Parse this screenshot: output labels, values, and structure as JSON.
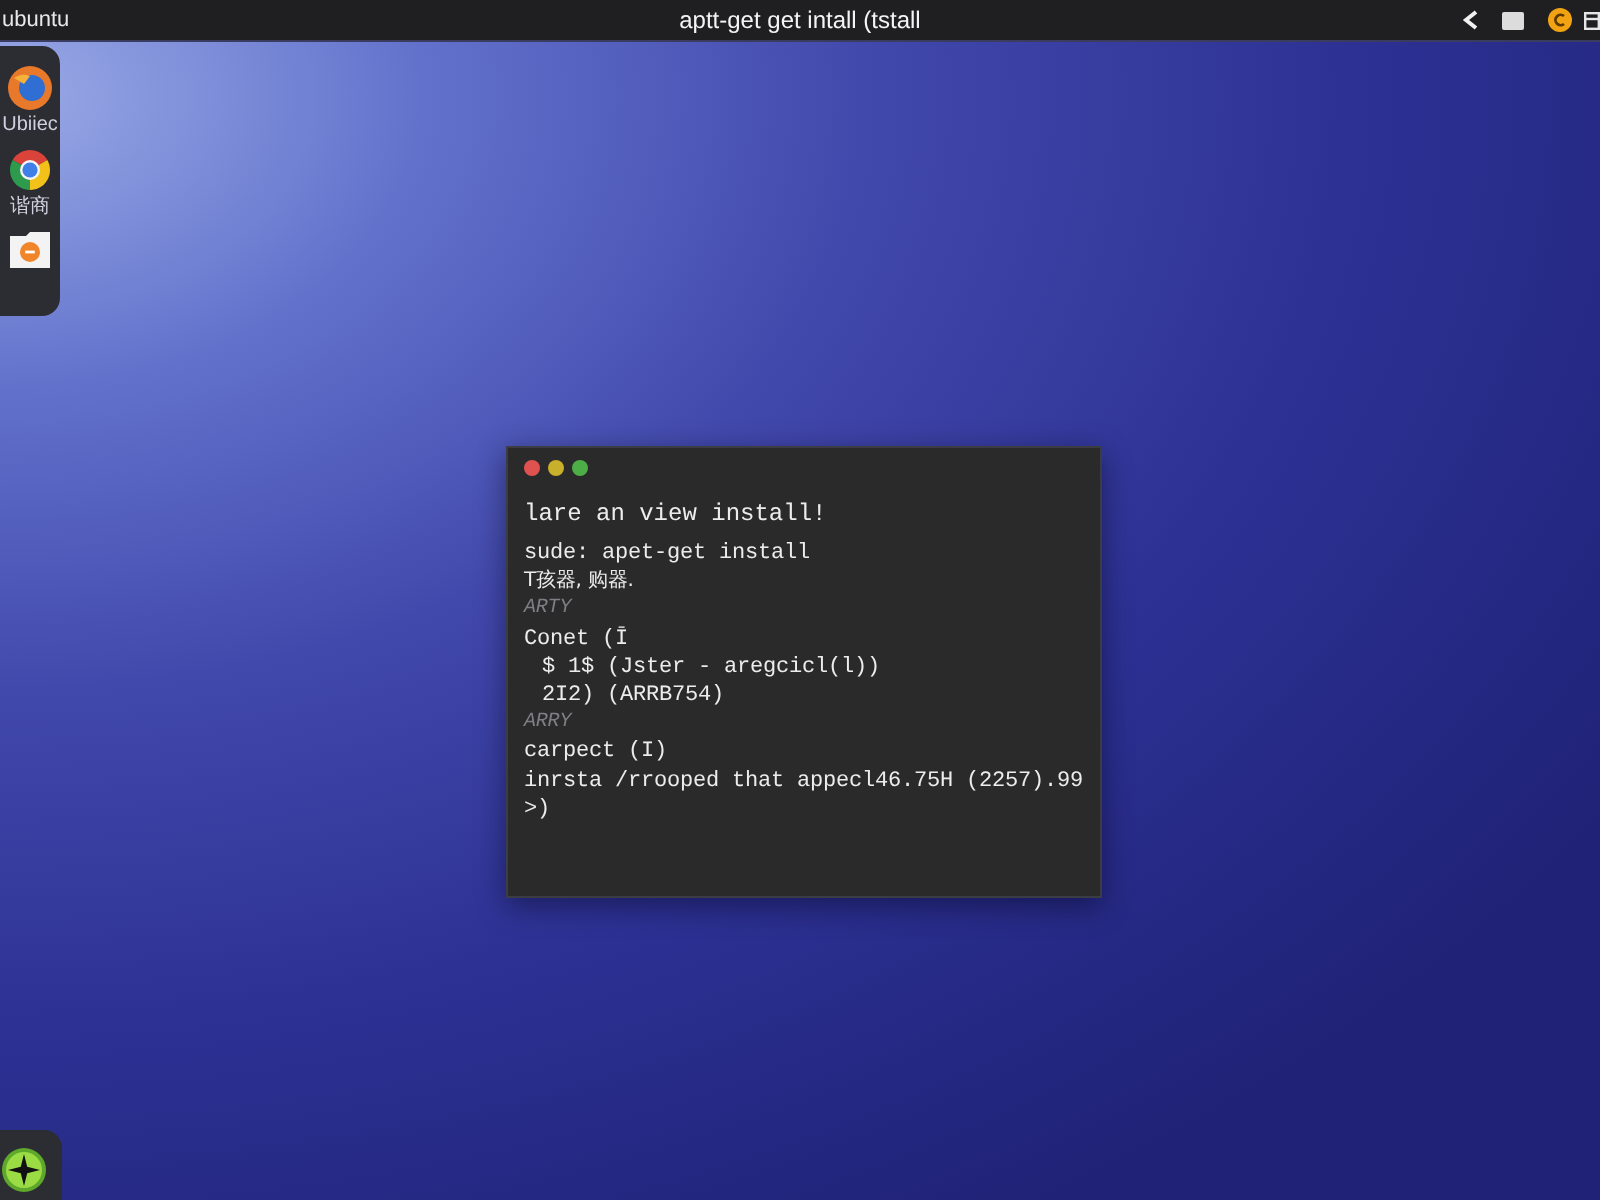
{
  "top_bar": {
    "brand": "ubuntu",
    "title": "aptt-get get intall (tstall"
  },
  "dock": {
    "items": [
      {
        "kind": "globe",
        "label": "Ubiiec"
      },
      {
        "kind": "wheel",
        "label": "谐商"
      },
      {
        "kind": "document"
      }
    ]
  },
  "terminal": {
    "lines": [
      {
        "kind": "title",
        "text": "lare an view install!"
      },
      {
        "kind": "command",
        "text": "sude: apet-get install"
      },
      {
        "kind": "cjk",
        "text": "T孩器, 购器."
      },
      {
        "kind": "comment",
        "text": "ARTY"
      },
      {
        "kind": "command",
        "text": "Conet (Ī"
      },
      {
        "kind": "indented",
        "text": "$ 1$ (Jster - aregcicl(l))"
      },
      {
        "kind": "indented",
        "text": "2I2) (ARRB754)"
      },
      {
        "kind": "comment",
        "text": "ARRY"
      },
      {
        "kind": "command",
        "text": "carpect (I)"
      },
      {
        "kind": "command",
        "text": "inrsta /rrooped that appecl46.75H (2257).99"
      },
      {
        "kind": "command",
        "text": ">)"
      }
    ]
  }
}
